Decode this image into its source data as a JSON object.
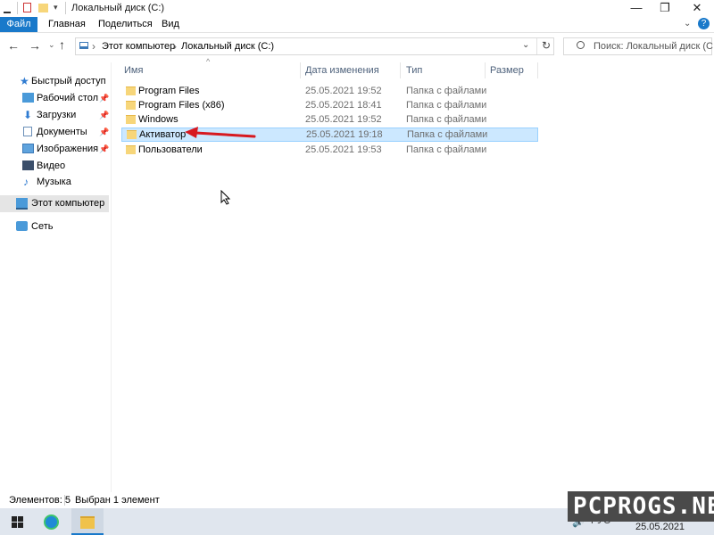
{
  "window": {
    "title": "Локальный диск (C:)",
    "controls": {
      "minimize": "—",
      "maximize": "❐",
      "close": "✕"
    }
  },
  "ribbon": {
    "tabs": [
      "Файл",
      "Главная",
      "Поделиться",
      "Вид"
    ]
  },
  "address": {
    "segments": [
      "Этот компьютер",
      "Локальный диск (C:)"
    ],
    "separator": "›"
  },
  "search": {
    "placeholder": "Поиск: Локальный диск (C:)"
  },
  "nav": {
    "quick_access": "Быстрый доступ",
    "items": [
      {
        "label": "Рабочий стол",
        "icon": "desktop-icon",
        "pinned": true
      },
      {
        "label": "Загрузки",
        "icon": "downloads-icon",
        "pinned": true
      },
      {
        "label": "Документы",
        "icon": "documents-icon",
        "pinned": true
      },
      {
        "label": "Изображения",
        "icon": "pictures-icon",
        "pinned": true
      },
      {
        "label": "Видео",
        "icon": "videos-icon",
        "pinned": false
      },
      {
        "label": "Музыка",
        "icon": "music-icon",
        "pinned": false
      }
    ],
    "this_pc": "Этот компьютер",
    "network": "Сеть",
    "pin_glyph": "📌"
  },
  "columns": {
    "name": "Имя",
    "date": "Дата изменения",
    "type": "Тип",
    "size": "Размер"
  },
  "files": [
    {
      "name": "Program Files",
      "date": "25.05.2021 19:52",
      "type": "Папка с файлами",
      "selected": false
    },
    {
      "name": "Program Files (x86)",
      "date": "25.05.2021 18:41",
      "type": "Папка с файлами",
      "selected": false
    },
    {
      "name": "Windows",
      "date": "25.05.2021 19:52",
      "type": "Папка с файлами",
      "selected": false
    },
    {
      "name": "Активатор",
      "date": "25.05.2021 19:18",
      "type": "Папка с файлами",
      "selected": true
    },
    {
      "name": "Пользователи",
      "date": "25.05.2021 19:53",
      "type": "Папка с файлами",
      "selected": false
    }
  ],
  "status": {
    "count": "Элементов: 5",
    "selection": "Выбран 1 элемент"
  },
  "taskbar": {
    "lang": "РУС",
    "date": "25.05.2021"
  },
  "watermark": "PCPROGS.NET",
  "colors": {
    "accent": "#1979ca",
    "selection_bg": "#cce8ff",
    "selection_border": "#99d1ff",
    "arrow": "#d71920",
    "folder": "#f7d67a",
    "taskbar": "#e0e6ee"
  }
}
